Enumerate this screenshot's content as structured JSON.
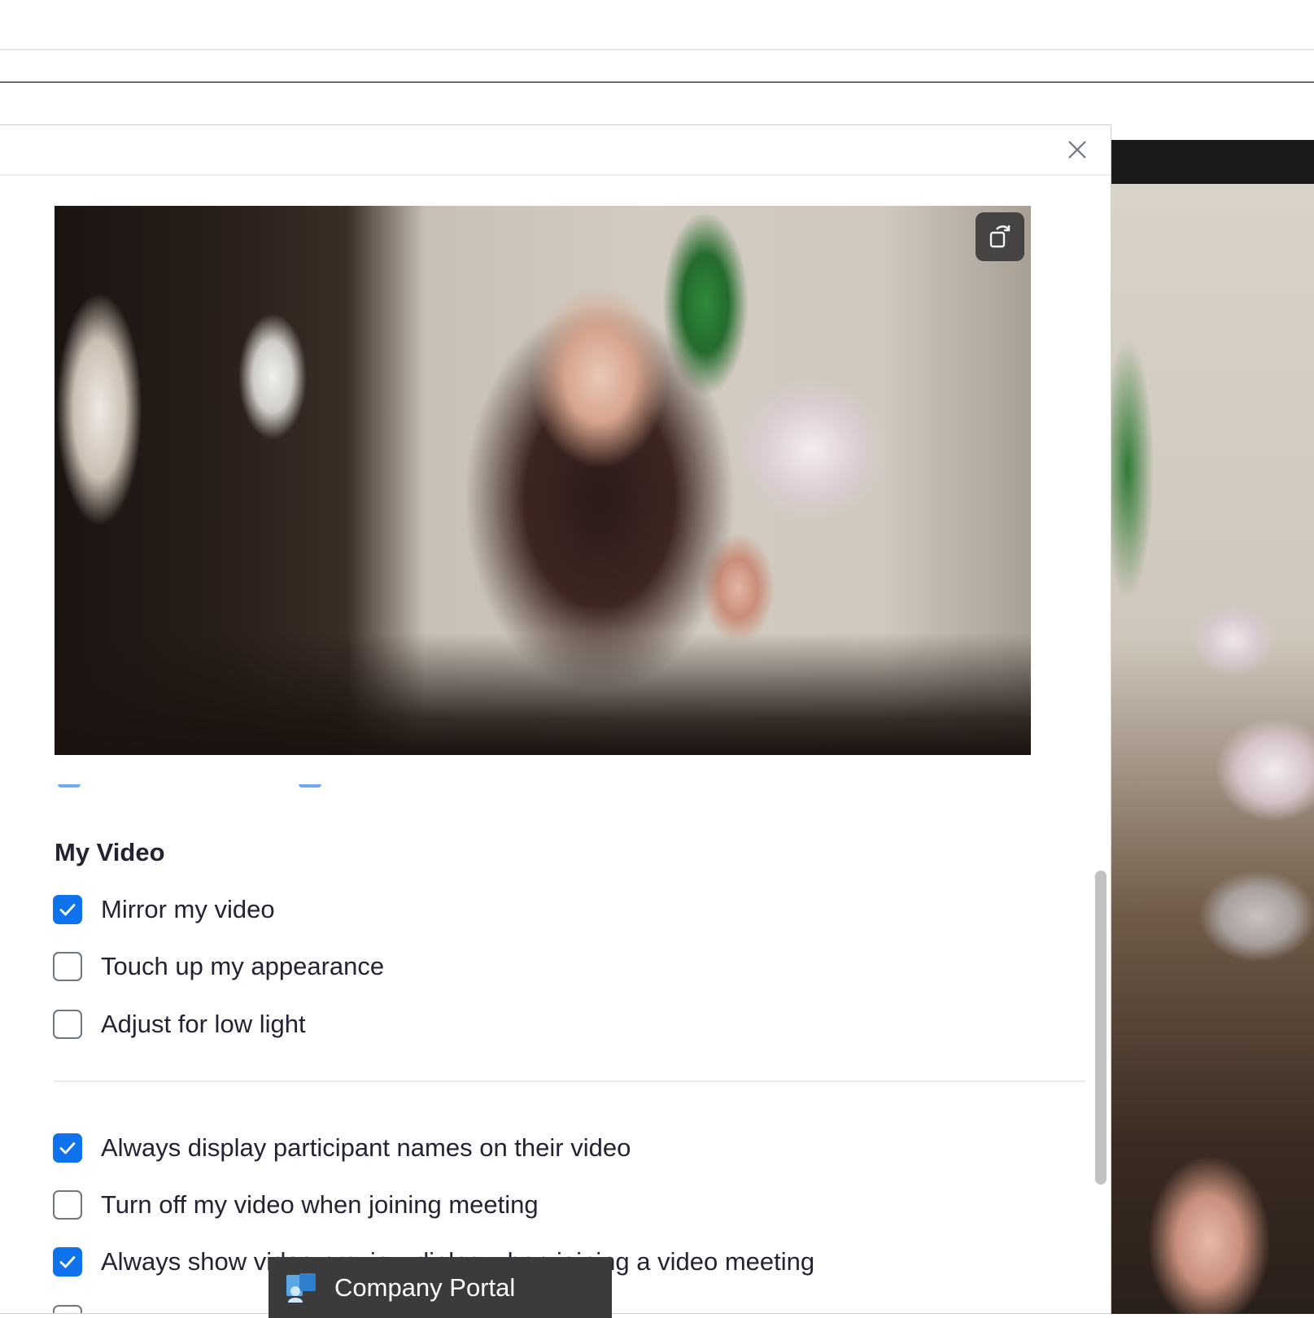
{
  "dialog": {
    "close_icon": "close-icon",
    "preview_rotate_icon": "rotate-icon",
    "section_title": "My Video",
    "video_options": [
      {
        "label": "Mirror my video",
        "checked": true
      },
      {
        "label": "Touch up my appearance",
        "checked": false
      },
      {
        "label": "Adjust for low light",
        "checked": false
      }
    ],
    "general_options": [
      {
        "label": "Always display participant names on their video",
        "checked": true
      },
      {
        "label": "Turn off my video when joining meeting",
        "checked": false
      },
      {
        "label": "Always show video preview dialog when joining a video meeting",
        "checked": true
      }
    ]
  },
  "notification": {
    "app_name": "Company Portal",
    "icon": "company-portal-icon"
  },
  "colors": {
    "accent": "#0e72ed",
    "text": "#232333",
    "toast_bg": "#3b3b3b"
  }
}
